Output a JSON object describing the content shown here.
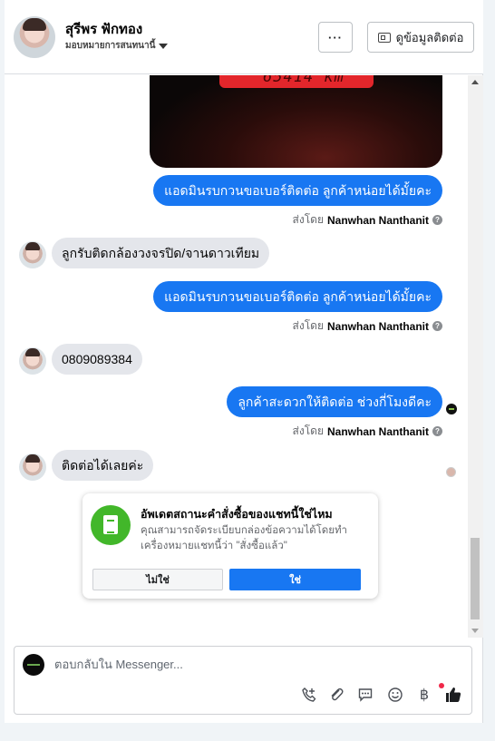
{
  "header": {
    "contact_name": "สุรีพร ฟักทอง",
    "assign_label": "มอบหมายการสนทนานี้",
    "more_label": "···",
    "contact_info_label": "ดูข้อมูลติดต่อ"
  },
  "image": {
    "odometer_text": "65414 km"
  },
  "messages": [
    {
      "direction": "out",
      "text": "แอดมินรบกวนขอเบอร์ติดต่อ ลูกค้าหน่อยได้มั้ยคะ",
      "sent_by_label": "ส่งโดย",
      "sender": "Nanwhan Nanthanit"
    },
    {
      "direction": "in",
      "text": "ลูกรับติดกล้องวงจรปิด/จานดาวเทียม"
    },
    {
      "direction": "out",
      "text": "แอดมินรบกวนขอเบอร์ติดต่อ ลูกค้าหน่อยได้มั้ยคะ",
      "sent_by_label": "ส่งโดย",
      "sender": "Nanwhan Nanthanit"
    },
    {
      "direction": "in",
      "text": "0809089384"
    },
    {
      "direction": "out",
      "text": "ลูกค้าสะดวกให้ติดต่อ ช่วงกี่โมงดีคะ",
      "sent_by_label": "ส่งโดย",
      "sender": "Nanwhan Nanthanit"
    },
    {
      "direction": "in",
      "text": "ติดต่อได้เลยค่ะ"
    }
  ],
  "prompt": {
    "title": "อัพเดตสถานะคำสั่งซื้อของแชทนี้ใช่ไหม",
    "body": "คุณสามารถจัดระเบียบกล่องข้อความได้โดยทำเครื่องหมายแชทนี้ว่า \"สั่งซื้อแล้ว\"",
    "no_label": "ไม่ใช่",
    "yes_label": "ใช่"
  },
  "composer": {
    "placeholder": "ตอบกลับใน Messenger...",
    "tools": [
      "call-add-icon",
      "paperclip-icon",
      "saved-reply-icon",
      "emoji-icon",
      "baht-icon",
      "thumbs-up-icon"
    ]
  },
  "colors": {
    "accent": "#1877f2",
    "incoming_bubble": "#e4e6eb",
    "prompt_icon": "#42b72a"
  }
}
